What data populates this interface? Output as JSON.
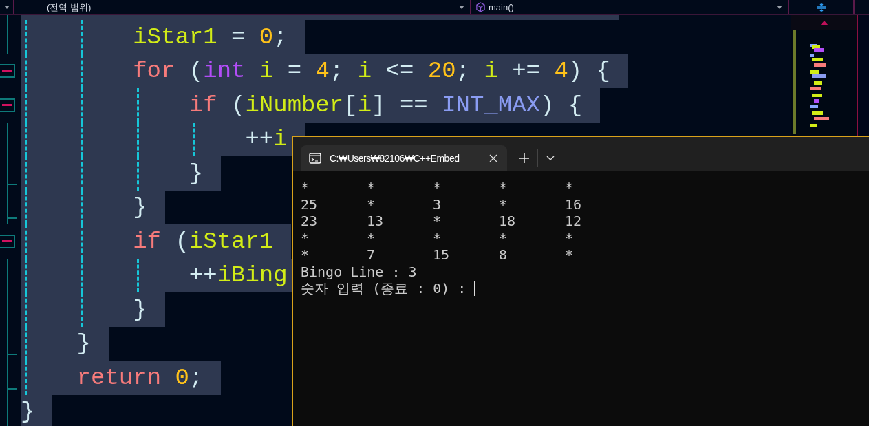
{
  "toolbar": {
    "scope_dropdown": "(전역 범위)",
    "function_dropdown": "main()"
  },
  "editor": {
    "lines": [
      {
        "kind": "plain",
        "tokens": [
          {
            "kind": "ident",
            "text": "        iStar1"
          },
          {
            "kind": "punct",
            "text": " = "
          },
          {
            "kind": "number",
            "text": "0"
          },
          {
            "kind": "punct",
            "text": ";"
          }
        ]
      },
      {
        "kind": "fold-start",
        "tokens": [
          {
            "kind": "keyword",
            "text": "        for"
          },
          {
            "kind": "punct",
            "text": " ("
          },
          {
            "kind": "type",
            "text": "int"
          },
          {
            "kind": "ident",
            "text": " i"
          },
          {
            "kind": "punct",
            "text": " = "
          },
          {
            "kind": "number",
            "text": "4"
          },
          {
            "kind": "punct",
            "text": "; "
          },
          {
            "kind": "ident",
            "text": "i"
          },
          {
            "kind": "punct",
            "text": " <= "
          },
          {
            "kind": "number",
            "text": "20"
          },
          {
            "kind": "punct",
            "text": "; "
          },
          {
            "kind": "ident",
            "text": "i"
          },
          {
            "kind": "punct",
            "text": " += "
          },
          {
            "kind": "number",
            "text": "4"
          },
          {
            "kind": "punct",
            "text": ") {"
          }
        ]
      },
      {
        "kind": "fold-start",
        "tokens": [
          {
            "kind": "keyword",
            "text": "            if"
          },
          {
            "kind": "punct",
            "text": " ("
          },
          {
            "kind": "ident",
            "text": "iNumber"
          },
          {
            "kind": "punct",
            "text": "["
          },
          {
            "kind": "ident",
            "text": "i"
          },
          {
            "kind": "punct",
            "text": "] == "
          },
          {
            "kind": "macro",
            "text": "INT_MAX"
          },
          {
            "kind": "punct",
            "text": ") {"
          }
        ]
      },
      {
        "kind": "plain",
        "tokens": [
          {
            "kind": "punct",
            "text": "                ++"
          },
          {
            "kind": "ident",
            "text": "i"
          }
        ]
      },
      {
        "kind": "fold-end",
        "tokens": [
          {
            "kind": "punct",
            "text": "            }"
          }
        ]
      },
      {
        "kind": "fold-end",
        "tokens": [
          {
            "kind": "punct",
            "text": "        }"
          }
        ]
      },
      {
        "kind": "fold-start",
        "tokens": [
          {
            "kind": "keyword",
            "text": "        if"
          },
          {
            "kind": "punct",
            "text": " ("
          },
          {
            "kind": "ident",
            "text": "iStar1"
          }
        ]
      },
      {
        "kind": "plain",
        "tokens": [
          {
            "kind": "punct",
            "text": "            ++"
          },
          {
            "kind": "ident",
            "text": "iBing"
          }
        ]
      },
      {
        "kind": "plain",
        "tokens": [
          {
            "kind": "punct",
            "text": "        }"
          }
        ]
      },
      {
        "kind": "fold-end",
        "tokens": [
          {
            "kind": "punct",
            "text": "    }"
          }
        ]
      },
      {
        "kind": "fold-end",
        "tokens": [
          {
            "kind": "keyword",
            "text": "    return"
          },
          {
            "kind": "number",
            "text": " 0"
          },
          {
            "kind": "punct",
            "text": ";"
          }
        ]
      },
      {
        "kind": "plain",
        "tokens": [
          {
            "kind": "punct",
            "text": "}"
          }
        ]
      }
    ]
  },
  "terminal": {
    "tab_title": "C:₩Users₩82106₩C++Embed",
    "rows": [
      [
        "*",
        "*",
        "*",
        "*",
        "*"
      ],
      [
        "25",
        "*",
        "3",
        "*",
        "16"
      ],
      [
        "23",
        "13",
        "*",
        "18",
        "12"
      ],
      [
        "*",
        "*",
        "*",
        "*",
        "*"
      ],
      [
        "*",
        "7",
        "15",
        "8",
        "*"
      ]
    ],
    "lines": [
      "Bingo Line : 3"
    ],
    "prompt": "숫자 입력 (종료 : 0) :",
    "cursor": true
  }
}
